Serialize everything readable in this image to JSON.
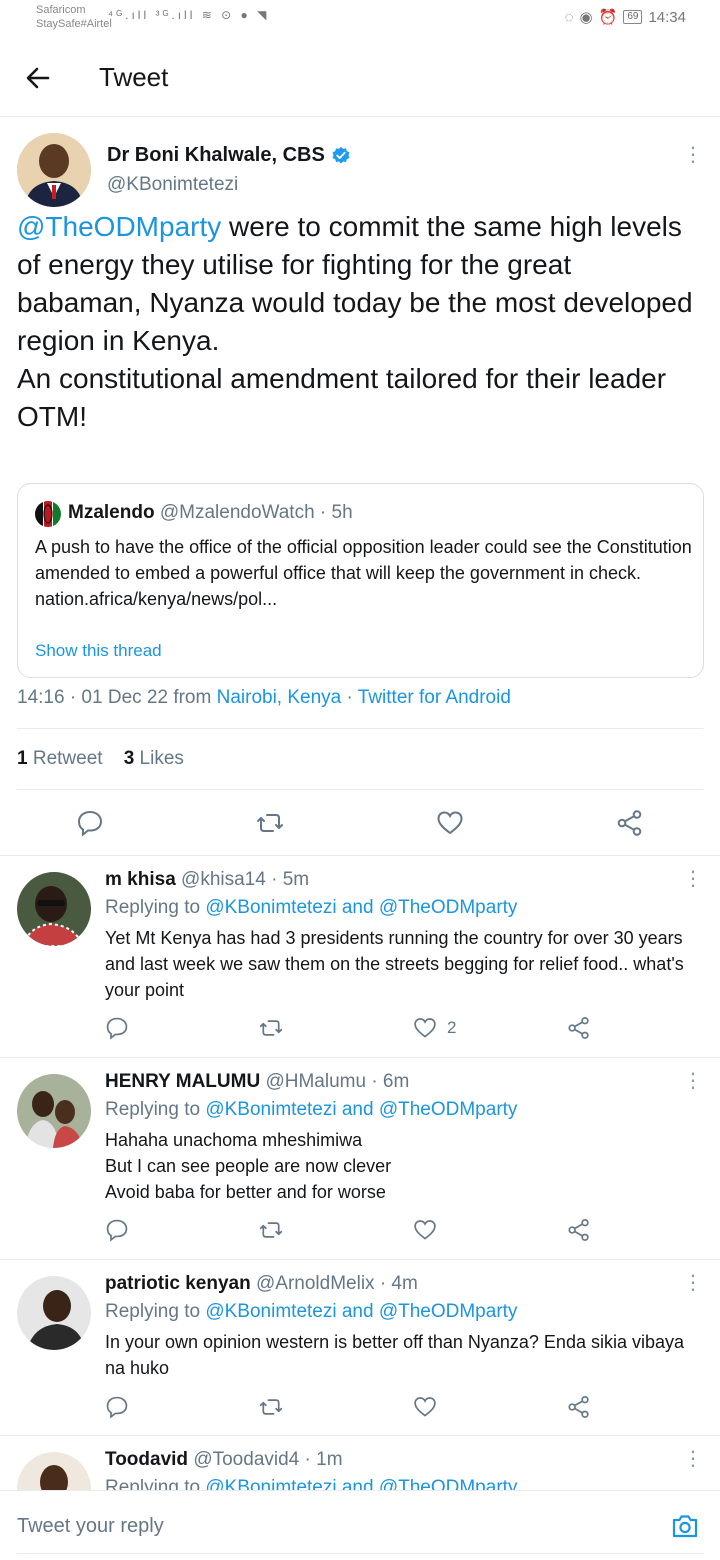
{
  "status_bar": {
    "carrier_line1": "Safaricom",
    "carrier_line2": "StaySafe#Airtel",
    "left_icons": "⁴ᴳ.ıll ³ᴳ.ıll ≋ ⊙ ● ◥",
    "battery": "69",
    "time": "14:34"
  },
  "header": {
    "title": "Tweet"
  },
  "tweet": {
    "author_name": "Dr Boni Khalwale, CBS",
    "author_handle": "@KBonimtetezi",
    "text_mention": "@TheODMparty",
    "text_part1": " were to commit the same high levels of energy they utilise for fighting for the great babaman, Nyanza would today be the most developed region in Kenya.",
    "text_line2": "An constitutional amendment tailored for their leader",
    "text_line3": "OTM!",
    "quote": {
      "name": "Mzalendo",
      "handle_time": "@MzalendoWatch · 5h",
      "body": "A push to have the office of the official opposition leader could see the Constitution amended to embed a powerful office that will keep the government in check.",
      "link": "nation.africa/kenya/news/pol...",
      "show_thread": "Show this thread"
    },
    "meta_time": "14:16 · 01 Dec 22 from ",
    "meta_location": "Nairobi, Kenya",
    "meta_sep": " · ",
    "meta_client": "Twitter for Android",
    "retweet_count": "1",
    "retweet_label": " Retweet",
    "like_count": "3",
    "like_label": " Likes"
  },
  "replies": [
    {
      "name": "m khisa",
      "handle_time": " @khisa14 · 5m",
      "replying_prefix": "Replying to ",
      "replying_to": "@KBonimtetezi and @TheODMparty",
      "text": "Yet Mt Kenya has had 3 presidents running the country for over 30 years and last week we saw them on the streets begging for relief food.. what's your point",
      "likes": "2"
    },
    {
      "name": "HENRY MALUMU",
      "handle_time": " @HMalumu · 6m",
      "replying_prefix": "Replying to ",
      "replying_to": "@KBonimtetezi and @TheODMparty",
      "text_lines": [
        "Hahaha unachoma mheshimiwa",
        "But I can see people are now clever",
        "Avoid baba for better and for worse"
      ]
    },
    {
      "name": "patriotic kenyan",
      "handle_time": " @ArnoldMelix · 4m",
      "replying_prefix": "Replying to ",
      "replying_to": "@KBonimtetezi and @TheODMparty",
      "text": "In your own opinion western is better off than Nyanza? Enda sikia vibaya na huko"
    },
    {
      "name": "Toodavid",
      "handle_time": " @Toodavid4 · 1m",
      "replying_prefix": "Replying to ",
      "replying_to": "@KBonimtetezi and @TheODMparty"
    }
  ],
  "reply_bar": {
    "placeholder": "Tweet your reply"
  },
  "colors": {
    "link": "#1b95e0",
    "muted": "#657786",
    "text": "#14171a",
    "divider": "#e6ecf0"
  }
}
